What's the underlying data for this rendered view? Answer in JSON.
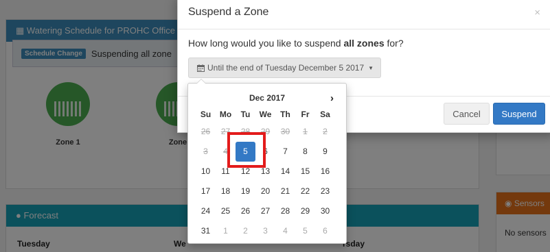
{
  "background": {
    "schedule_title": "Watering Schedule for PROHC Office",
    "schedule_change_badge": "Schedule Change",
    "schedule_change_text": "Suspending all zone",
    "zones": [
      "Zone 1",
      "Zone"
    ],
    "forecast_title": "Forecast",
    "forecast_days": [
      "Tuesday",
      "We",
      "rsday"
    ],
    "sensors_title": "Sensors",
    "sensors_text": "No sensors"
  },
  "modal": {
    "title": "Suspend a Zone",
    "close_label": "×",
    "question_prefix": "How long would you like to suspend ",
    "question_bold": "all zones",
    "question_suffix": " for?",
    "date_button_label": "Until the end of Tuesday December 5 2017",
    "cancel_label": "Cancel",
    "suspend_label": "Suspend"
  },
  "datepicker": {
    "month_label": "Dec 2017",
    "next_label": "›",
    "weekdays": [
      "Su",
      "Mo",
      "Tu",
      "We",
      "Th",
      "Fr",
      "Sa"
    ],
    "selected_day": "5",
    "weeks": [
      [
        {
          "d": "26",
          "s": "disabled"
        },
        {
          "d": "27",
          "s": "disabled"
        },
        {
          "d": "28",
          "s": "disabled"
        },
        {
          "d": "29",
          "s": "disabled"
        },
        {
          "d": "30",
          "s": "disabled"
        },
        {
          "d": "1",
          "s": "disabled"
        },
        {
          "d": "2",
          "s": "disabled"
        }
      ],
      [
        {
          "d": "3",
          "s": "disabled"
        },
        {
          "d": "4",
          "s": "disabled"
        },
        {
          "d": "5",
          "s": "active"
        },
        {
          "d": "6",
          "s": ""
        },
        {
          "d": "7",
          "s": ""
        },
        {
          "d": "8",
          "s": ""
        },
        {
          "d": "9",
          "s": ""
        }
      ],
      [
        {
          "d": "10",
          "s": ""
        },
        {
          "d": "11",
          "s": ""
        },
        {
          "d": "12",
          "s": ""
        },
        {
          "d": "13",
          "s": ""
        },
        {
          "d": "14",
          "s": ""
        },
        {
          "d": "15",
          "s": ""
        },
        {
          "d": "16",
          "s": ""
        }
      ],
      [
        {
          "d": "17",
          "s": ""
        },
        {
          "d": "18",
          "s": ""
        },
        {
          "d": "19",
          "s": ""
        },
        {
          "d": "20",
          "s": ""
        },
        {
          "d": "21",
          "s": ""
        },
        {
          "d": "22",
          "s": ""
        },
        {
          "d": "23",
          "s": ""
        }
      ],
      [
        {
          "d": "24",
          "s": ""
        },
        {
          "d": "25",
          "s": ""
        },
        {
          "d": "26",
          "s": ""
        },
        {
          "d": "27",
          "s": ""
        },
        {
          "d": "28",
          "s": ""
        },
        {
          "d": "29",
          "s": ""
        },
        {
          "d": "30",
          "s": ""
        }
      ],
      [
        {
          "d": "31",
          "s": ""
        },
        {
          "d": "1",
          "s": "new"
        },
        {
          "d": "2",
          "s": "new"
        },
        {
          "d": "3",
          "s": "new"
        },
        {
          "d": "4",
          "s": "new"
        },
        {
          "d": "5",
          "s": "new"
        },
        {
          "d": "6",
          "s": "new"
        }
      ]
    ]
  },
  "colors": {
    "primary": "#3379c5",
    "highlight": "#e31b1b",
    "zone_green": "#4caf50"
  },
  "icons": {
    "calendar": "calendar-icon",
    "forecast": "circle-icon",
    "sensors": "radio-icon"
  }
}
